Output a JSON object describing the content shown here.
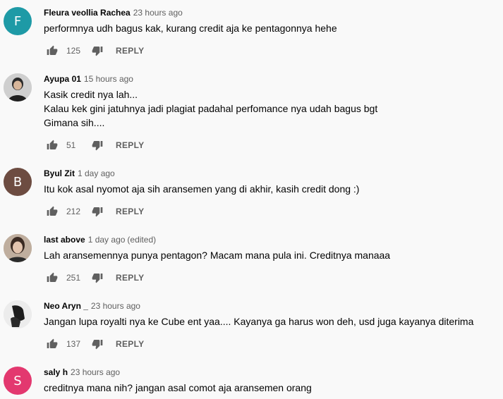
{
  "comments": [
    {
      "author": "Fleura veollia Rachea",
      "time": "23 hours ago",
      "edited": "",
      "avatar_letter": "F",
      "avatar_color": "#1e9aa6",
      "lines": [
        "performnya udh bagus kak, kurang credit aja ke pentagonnya hehe"
      ],
      "likes": "125",
      "reply_label": "REPLY"
    },
    {
      "author": "Ayupa 01",
      "time": "15 hours ago",
      "edited": "",
      "avatar_letter": "",
      "avatar_color": "#6b6b6b",
      "lines": [
        "Kasik credit nya lah...",
        "Kalau kek gini jatuhnya jadi plagiat padahal perfomance nya udah bagus bgt",
        "Gimana sih...."
      ],
      "likes": "51",
      "reply_label": "REPLY"
    },
    {
      "author": "Byul Zit",
      "time": "1 day ago",
      "edited": "",
      "avatar_letter": "B",
      "avatar_color": "#6d4c41",
      "lines": [
        "Itu kok asal nyomot aja sih aransemen yang di akhir, kasih credit dong :)"
      ],
      "likes": "212",
      "reply_label": "REPLY"
    },
    {
      "author": "last above",
      "time": "1 day ago",
      "edited": "(edited)",
      "avatar_letter": "",
      "avatar_color": "#8a6e5a",
      "lines": [
        "Lah aransemennya punya pentagon? Macam mana pula ini. Creditnya manaaa"
      ],
      "likes": "251",
      "reply_label": "REPLY"
    },
    {
      "author": "Neo Aryn _",
      "time": "23 hours ago",
      "edited": "",
      "avatar_letter": "",
      "avatar_color": "#e6e6e6",
      "lines": [
        "Jangan lupa royalti nya ke Cube ent yaa.... Kayanya ga harus won deh, usd juga kayanya diterima"
      ],
      "likes": "137",
      "reply_label": "REPLY"
    },
    {
      "author": "saly h",
      "time": "23 hours ago",
      "edited": "",
      "avatar_letter": "S",
      "avatar_color": "#e3386f",
      "lines": [
        "creditnya mana nih? jangan asal comot aja aransemen orang"
      ],
      "likes": "",
      "reply_label": ""
    }
  ]
}
